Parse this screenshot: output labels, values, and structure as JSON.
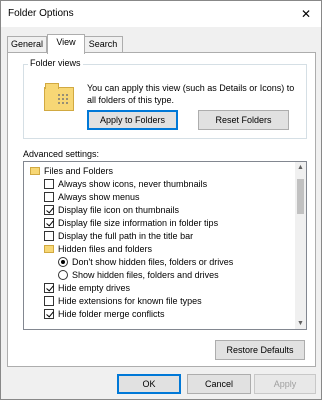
{
  "window": {
    "title": "Folder Options",
    "close_glyph": "✕"
  },
  "tabs": [
    {
      "label": "General",
      "active": false
    },
    {
      "label": "View",
      "active": true
    },
    {
      "label": "Search",
      "active": false
    }
  ],
  "folder_views": {
    "label": "Folder views",
    "description": "You can apply this view (such as Details or Icons) to all folders of this type.",
    "apply_button": "Apply to Folders",
    "reset_button": "Reset Folders"
  },
  "advanced": {
    "label": "Advanced settings:",
    "items": [
      {
        "type": "folder",
        "label": "Files and Folders",
        "indent": 0
      },
      {
        "type": "checkbox",
        "label": "Always show icons, never thumbnails",
        "checked": false,
        "indent": 1
      },
      {
        "type": "checkbox",
        "label": "Always show menus",
        "checked": false,
        "indent": 1
      },
      {
        "type": "checkbox",
        "label": "Display file icon on thumbnails",
        "checked": true,
        "indent": 1
      },
      {
        "type": "checkbox",
        "label": "Display file size information in folder tips",
        "checked": true,
        "indent": 1
      },
      {
        "type": "checkbox",
        "label": "Display the full path in the title bar",
        "checked": false,
        "indent": 1
      },
      {
        "type": "folder",
        "label": "Hidden files and folders",
        "indent": 1
      },
      {
        "type": "radio",
        "label": "Don't show hidden files, folders or drives",
        "checked": true,
        "indent": 2
      },
      {
        "type": "radio",
        "label": "Show hidden files, folders and drives",
        "checked": false,
        "indent": 2
      },
      {
        "type": "checkbox",
        "label": "Hide empty drives",
        "checked": true,
        "indent": 1
      },
      {
        "type": "checkbox",
        "label": "Hide extensions for known file types",
        "checked": false,
        "indent": 1
      },
      {
        "type": "checkbox",
        "label": "Hide folder merge conflicts",
        "checked": true,
        "indent": 1
      }
    ]
  },
  "restore_button": "Restore Defaults",
  "footer": {
    "ok": "OK",
    "cancel": "Cancel",
    "apply": "Apply"
  },
  "colors": {
    "accent": "#0078d7",
    "folder": "#f7d775"
  }
}
